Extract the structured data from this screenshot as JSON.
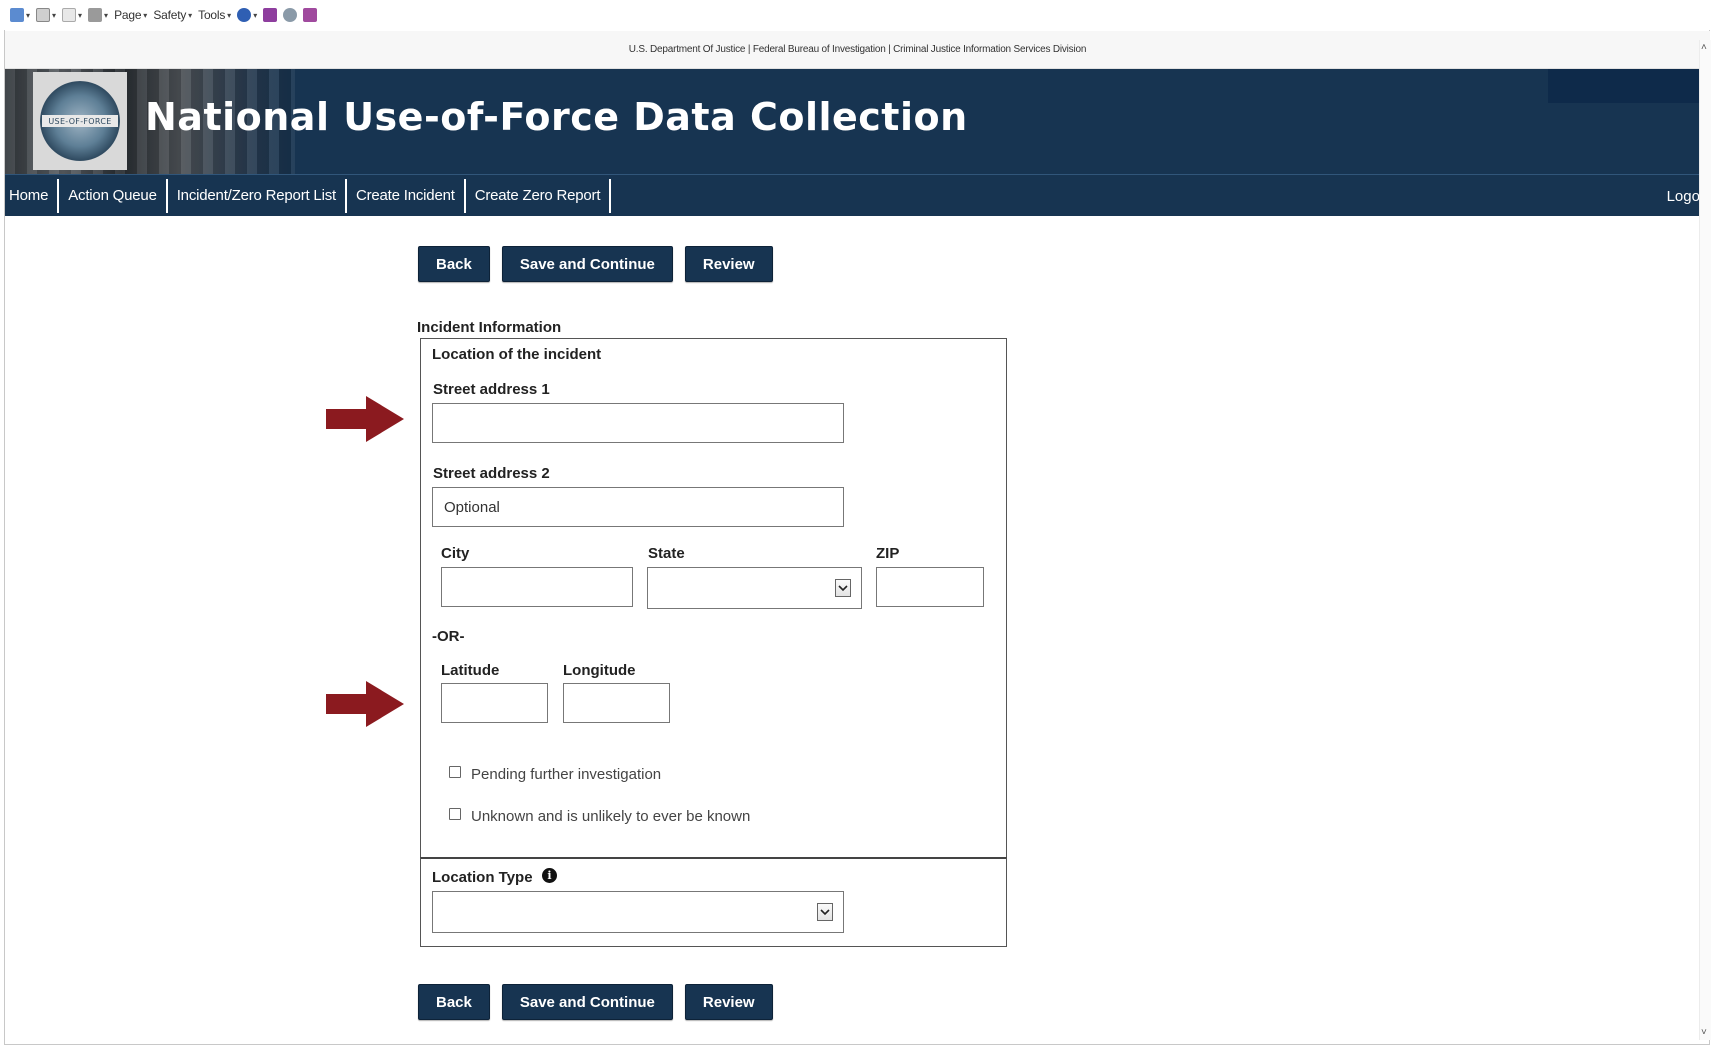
{
  "browser_toolbar": {
    "page_menu": "Page",
    "safety_menu": "Safety",
    "tools_menu": "Tools"
  },
  "gov_strip": {
    "text": "U.S. Department Of Justice | Federal Bureau of Investigation | Criminal Justice Information Services Division"
  },
  "banner": {
    "title": "National Use-of-Force Data Collection",
    "seal_text": "USE-OF-FORCE"
  },
  "nav": {
    "items": [
      {
        "label": "Home"
      },
      {
        "label": "Action Queue"
      },
      {
        "label": "Incident/Zero Report List"
      },
      {
        "label": "Create Incident"
      },
      {
        "label": "Create Zero Report"
      }
    ],
    "logoff": "Logoff"
  },
  "buttons": {
    "back": "Back",
    "save": "Save and Continue",
    "review": "Review"
  },
  "form": {
    "section_title": "Incident Information",
    "location_legend": "Location of the incident",
    "street1_label": "Street address 1",
    "street1_value": "",
    "street2_label": "Street address 2",
    "street2_placeholder": "Optional",
    "city_label": "City",
    "state_label": "State",
    "zip_label": "ZIP",
    "or_text": "-OR-",
    "latitude_label": "Latitude",
    "longitude_label": "Longitude",
    "pending_label": "Pending further investigation",
    "unknown_label": "Unknown and is unlikely to ever be known",
    "location_type_label": "Location Type"
  },
  "colors": {
    "navy": "#173451",
    "arrow": "#8b1a1f"
  }
}
